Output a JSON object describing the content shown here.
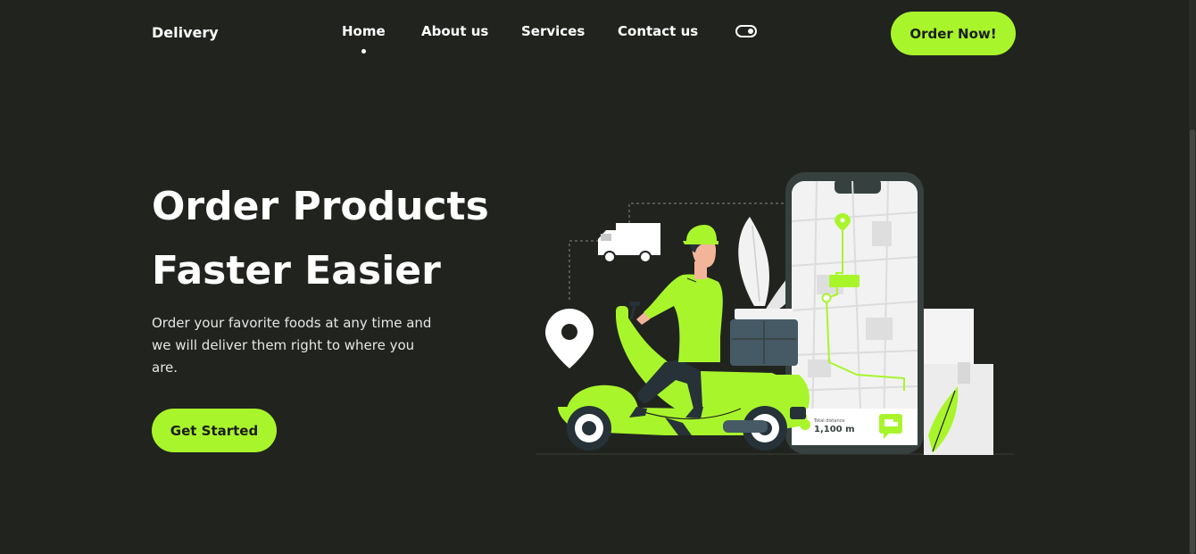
{
  "nav": {
    "logo": "Delivery",
    "links": [
      "Home",
      "About us",
      "Services",
      "Contact us"
    ],
    "active_index": 0,
    "theme_toggle_icon": "toggle-icon",
    "order_button": "Order Now!"
  },
  "hero": {
    "title_line1": "Order Products",
    "title_line2": "Faster Easier",
    "description": "Order your favorite foods at any time and we will deliver them right to where you are.",
    "cta": "Get Started"
  },
  "illustration": {
    "distance_label": "Total distance",
    "distance_value": "1,100 m"
  },
  "colors": {
    "background": "#21231f",
    "accent": "#a9f52c",
    "text": "#ffffff"
  }
}
